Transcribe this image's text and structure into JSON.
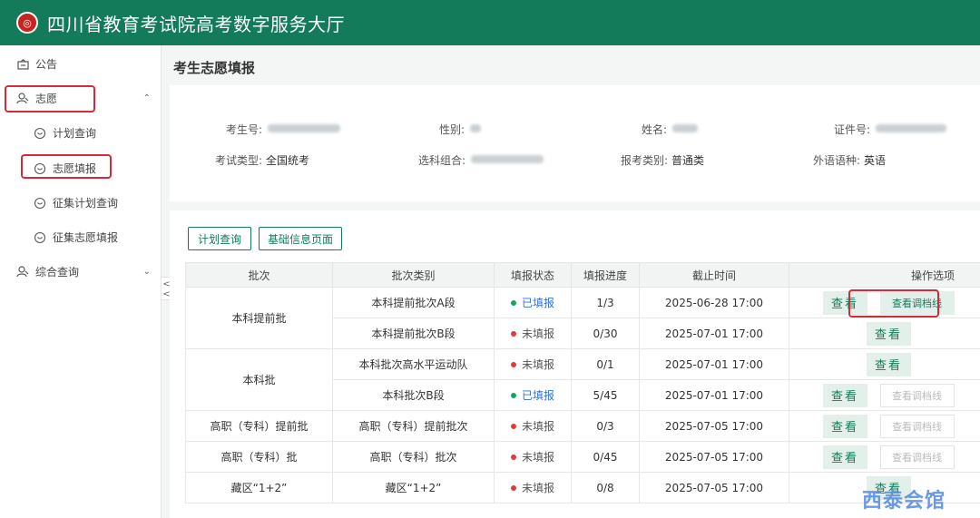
{
  "app": {
    "title": "四川省教育考试院高考数字服务大厅",
    "logo_text": "◎"
  },
  "sidebar": {
    "items": [
      {
        "label": "公告",
        "icon": "notice-icon"
      },
      {
        "label": "志愿",
        "icon": "user-icon",
        "expanded": true
      },
      {
        "label": "计划查询",
        "icon": "circle-face-icon"
      },
      {
        "label": "志愿填报",
        "icon": "circle-face-icon",
        "selected": true
      },
      {
        "label": "征集计划查询",
        "icon": "circle-face-icon"
      },
      {
        "label": "征集志愿填报",
        "icon": "circle-face-icon"
      },
      {
        "label": "综合查询",
        "icon": "user-icon",
        "expanded": false
      }
    ],
    "collapse_glyph": "<\n<"
  },
  "page": {
    "title": "考生志愿填报"
  },
  "student_info": {
    "exam_no_label": "考生号:",
    "gender_label": "性别:",
    "name_label": "姓名:",
    "id_label": "证件号:",
    "exam_type_label": "考试类型:",
    "exam_type_value": "全国统考",
    "subjects_label": "选科组合:",
    "category_label": "报考类别:",
    "category_value": "普通类",
    "language_label": "外语语种:",
    "language_value": "英语"
  },
  "toolbar": {
    "plan_query": "计划查询",
    "basic_info": "基础信息页面"
  },
  "table": {
    "headers": [
      "批次",
      "批次类别",
      "填报状态",
      "填报进度",
      "截止时间",
      "操作选项"
    ],
    "batches": [
      {
        "name": "本科提前批",
        "rows": [
          {
            "category": "本科提前批次A段",
            "status": "已填报",
            "done": true,
            "progress": "1/3",
            "deadline": "2025-06-28 17:00",
            "adj": "on"
          },
          {
            "category": "本科提前批次B段",
            "status": "未填报",
            "done": false,
            "progress": "0/30",
            "deadline": "2025-07-01 17:00",
            "adj": "none"
          }
        ]
      },
      {
        "name": "本科批",
        "rows": [
          {
            "category": "本科批次高水平运动队",
            "status": "未填报",
            "done": false,
            "progress": "0/1",
            "deadline": "2025-07-01 17:00",
            "adj": "none"
          },
          {
            "category": "本科批次B段",
            "status": "已填报",
            "done": true,
            "progress": "5/45",
            "deadline": "2025-07-01 17:00",
            "adj": "off"
          }
        ]
      },
      {
        "name": "高职（专科）提前批",
        "rows": [
          {
            "category": "高职（专科）提前批次",
            "status": "未填报",
            "done": false,
            "progress": "0/3",
            "deadline": "2025-07-05 17:00",
            "adj": "off"
          }
        ]
      },
      {
        "name": "高职（专科）批",
        "rows": [
          {
            "category": "高职（专科）批次",
            "status": "未填报",
            "done": false,
            "progress": "0/45",
            "deadline": "2025-07-05 17:00",
            "adj": "off"
          }
        ]
      },
      {
        "name": "藏区“1+2”",
        "rows": [
          {
            "category": "藏区“1+2”",
            "status": "未填报",
            "done": false,
            "progress": "0/8",
            "deadline": "2025-07-05 17:00",
            "adj": "none"
          }
        ]
      }
    ],
    "view_label": "查看",
    "adj_label": "查看调档线"
  },
  "watermark": "西泰会馆",
  "colors": {
    "brand": "#137a5a",
    "highlight": "#d42a3a",
    "done_dot": "#1aa35f",
    "not_dot": "#e03b3b",
    "done_text": "#2e6fd8"
  }
}
